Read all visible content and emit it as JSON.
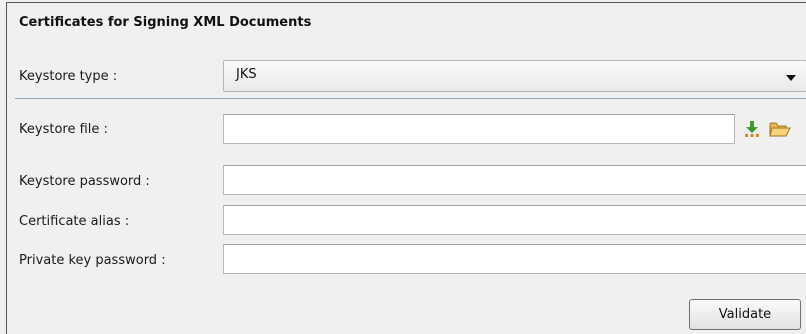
{
  "section": {
    "title": "Certificates for Signing XML Documents"
  },
  "fields": {
    "keystore_type": {
      "label": "Keystore type :",
      "value": "JKS"
    },
    "keystore_file": {
      "label": "Keystore file :",
      "value": ""
    },
    "keystore_password": {
      "label": "Keystore password :",
      "value": ""
    },
    "certificate_alias": {
      "label": "Certificate alias :",
      "value": ""
    },
    "private_key_password": {
      "label": "Private key password :",
      "value": ""
    }
  },
  "buttons": {
    "validate": "Validate"
  },
  "icons": {
    "download": "download-icon",
    "folder": "folder-open-icon"
  }
}
